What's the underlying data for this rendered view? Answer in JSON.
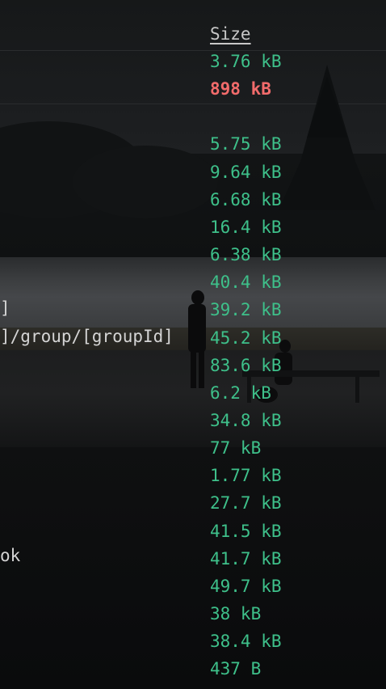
{
  "terminal": {
    "header": "Size",
    "route_fragments": [
      "]",
      "]/group/[groupId]",
      "ok"
    ],
    "sizes": [
      {
        "text": "3.76 kB",
        "color": "#3ec08a"
      },
      {
        "text": "898 kB",
        "color": "#f26b6b"
      },
      {
        "text": "",
        "color": "#3ec08a"
      },
      {
        "text": "5.75 kB",
        "color": "#3ec08a"
      },
      {
        "text": "9.64 kB",
        "color": "#3ec08a"
      },
      {
        "text": "6.68 kB",
        "color": "#3ec08a"
      },
      {
        "text": "16.4 kB",
        "color": "#3ec08a"
      },
      {
        "text": "6.38 kB",
        "color": "#3ec08a"
      },
      {
        "text": "40.4 kB",
        "color": "#3ec08a"
      },
      {
        "text": "39.2 kB",
        "color": "#3ec08a"
      },
      {
        "text": "45.2 kB",
        "color": "#3ec08a"
      },
      {
        "text": "83.6 kB",
        "color": "#3ec08a"
      },
      {
        "text": "6.2 kB",
        "color": "#3ec08a"
      },
      {
        "text": "34.8 kB",
        "color": "#3ec08a"
      },
      {
        "text": "77 kB",
        "color": "#3ec08a"
      },
      {
        "text": "1.77 kB",
        "color": "#3ec08a"
      },
      {
        "text": "27.7 kB",
        "color": "#3ec08a"
      },
      {
        "text": "41.5 kB",
        "color": "#3ec08a"
      },
      {
        "text": "41.7 kB",
        "color": "#3ec08a"
      },
      {
        "text": "49.7 kB",
        "color": "#3ec08a"
      },
      {
        "text": "38 kB",
        "color": "#3ec08a"
      },
      {
        "text": "38.4 kB",
        "color": "#3ec08a"
      },
      {
        "text": "437 B",
        "color": "#3ec08a"
      }
    ]
  }
}
